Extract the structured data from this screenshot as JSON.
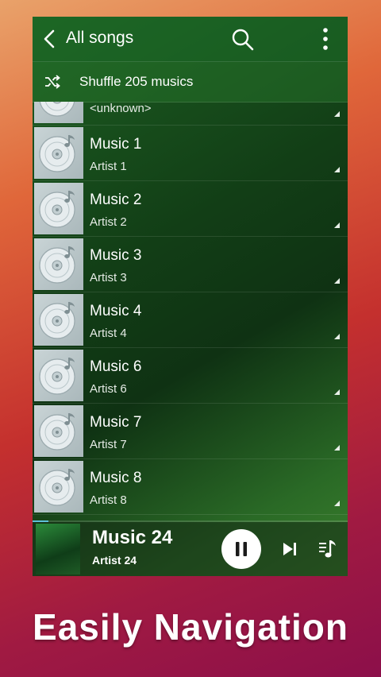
{
  "header": {
    "title": "All songs",
    "back_icon": "chevron-left-icon",
    "search_icon": "search-icon",
    "more_icon": "more-vertical-icon"
  },
  "shuffle": {
    "label": "Shuffle 205 musics",
    "icon": "shuffle-icon"
  },
  "songs": [
    {
      "title": "",
      "artist": "<unknown>"
    },
    {
      "title": "Music 1",
      "artist": "Artist 1"
    },
    {
      "title": "Music 2",
      "artist": "Artist 2"
    },
    {
      "title": "Music 3",
      "artist": "Artist 3"
    },
    {
      "title": "Music 4",
      "artist": "Artist 4"
    },
    {
      "title": "Music 6",
      "artist": "Artist 6"
    },
    {
      "title": "Music 7",
      "artist": "Artist 7"
    },
    {
      "title": "Music 8",
      "artist": "Artist 8"
    }
  ],
  "now_playing": {
    "title": "Music 24",
    "artist": "Artist 24",
    "progress_fraction": 0.05,
    "pause_icon": "pause-icon",
    "next_icon": "skip-next-icon",
    "queue_icon": "queue-music-icon"
  },
  "caption": "Easily Navigation",
  "colors": {
    "accent": "#5ec1d8",
    "header_green": "#1e6e28"
  }
}
